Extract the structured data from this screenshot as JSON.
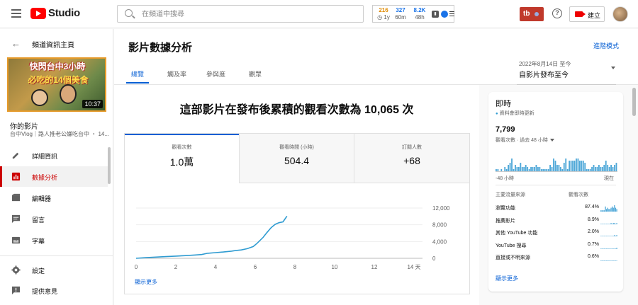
{
  "topbar": {
    "logo_text": "Studio",
    "search_placeholder": "在頻道中搜尋",
    "stats": [
      {
        "value": "216",
        "sub": "◷ 1y",
        "color": "#e08a00"
      },
      {
        "value": "327",
        "sub": "60m",
        "color": "#1a73e8"
      },
      {
        "value": "8.2K",
        "sub": "48h",
        "color": "#1a73e8"
      }
    ],
    "tb_label": "tb",
    "create_label": "建立"
  },
  "sidebar": {
    "back_label": "頻道資訊主頁",
    "thumbnail": {
      "title_line1": "快閃台中3小時",
      "title_line2": "必吃的14個美食",
      "duration": "10:37"
    },
    "your_video_label": "你的影片",
    "video_meta": "台中Vlog｜路人推老公嫌吃台中 ・ 14...",
    "items": [
      {
        "label": "詳細資訊",
        "icon": "pencil-icon",
        "active": false
      },
      {
        "label": "數據分析",
        "icon": "analytics-icon",
        "active": true
      },
      {
        "label": "編輯器",
        "icon": "film-icon",
        "active": false
      },
      {
        "label": "留言",
        "icon": "comment-icon",
        "active": false
      },
      {
        "label": "字幕",
        "icon": "subtitles-icon",
        "active": false
      },
      {
        "label": "設定",
        "icon": "gear-icon",
        "active": false
      },
      {
        "label": "提供意見",
        "icon": "feedback-icon",
        "active": false
      }
    ]
  },
  "main": {
    "title": "影片數據分析",
    "advanced_mode": "進階模式",
    "tabs": [
      {
        "label": "總覽",
        "active": true
      },
      {
        "label": "觸及率",
        "active": false
      },
      {
        "label": "參與度",
        "active": false
      },
      {
        "label": "觀眾",
        "active": false
      }
    ],
    "date_range_small": "2022年8月14日 至今",
    "date_range": "自影片發布至今",
    "headline": "這部影片在發布後累積的觀看次數為 10,065 次",
    "metrics": [
      {
        "label": "觀看次數",
        "value": "1.0萬",
        "active": true
      },
      {
        "label": "觀看時間 (小時)",
        "value": "504.4",
        "active": false
      },
      {
        "label": "訂閱人數",
        "value": "+68",
        "active": false
      }
    ],
    "show_more": "顯示更多"
  },
  "chart_data": {
    "type": "line",
    "x_ticks": [
      "0",
      "2",
      "4",
      "6",
      "8",
      "10",
      "12",
      "14 天"
    ],
    "y_ticks": [
      "0",
      "4,000",
      "8,000",
      "12,000"
    ],
    "xlim": [
      0,
      14
    ],
    "ylim": [
      0,
      12000
    ],
    "x": [
      0,
      0.5,
      1,
      1.5,
      2,
      2.5,
      3,
      3.3,
      3.6,
      4,
      4.4,
      4.8,
      5,
      5.3,
      5.6,
      5.9,
      6.1,
      6.4,
      6.6,
      6.8,
      7,
      7.2,
      7.4,
      7.6
    ],
    "y": [
      0,
      150,
      280,
      400,
      520,
      650,
      800,
      900,
      1200,
      1350,
      1500,
      1700,
      1850,
      2000,
      2300,
      2800,
      3600,
      5000,
      6200,
      7300,
      8100,
      8500,
      8700,
      10065
    ],
    "color": "#2e9bd1"
  },
  "realtime": {
    "title": "即時",
    "subtitle": "資料會即時更新",
    "count": "7,799",
    "count_label": "觀看次數 · 過去 48 小時",
    "axis_left": "-48 小時",
    "axis_right": "現在",
    "bar_values": [
      1,
      1,
      0,
      1,
      0,
      2,
      1,
      3,
      4,
      6,
      1,
      3,
      2,
      2,
      4,
      2,
      2,
      3,
      2,
      1,
      2,
      2,
      2,
      3,
      2,
      2,
      1,
      1,
      1,
      1,
      1,
      3,
      2,
      6,
      5,
      3,
      3,
      2,
      1,
      4,
      6,
      1,
      5,
      5,
      5,
      5,
      6,
      6,
      5,
      5,
      5,
      4,
      1,
      1,
      1,
      2,
      3,
      2,
      2,
      3,
      2,
      2,
      3,
      5,
      3,
      2,
      3,
      2,
      3,
      4
    ],
    "sources_header": "主要流量來源",
    "views_header": "觀看次數",
    "sources": [
      {
        "name": "瀏覽功能",
        "pct": "87.4%",
        "spark": [
          1,
          1,
          1,
          1,
          4,
          2,
          3,
          2,
          2,
          3,
          4,
          3,
          5,
          3,
          2
        ]
      },
      {
        "name": "推薦影片",
        "pct": "8.9%",
        "spark": [
          0,
          0,
          0,
          0,
          0,
          0,
          0,
          0,
          0,
          1,
          0,
          1,
          1,
          0,
          1
        ]
      },
      {
        "name": "其他 YouTube 功能",
        "pct": "2.0%",
        "spark": [
          0,
          0,
          0,
          0,
          0,
          0,
          0,
          0,
          0,
          0,
          0,
          0,
          1,
          0,
          1
        ]
      },
      {
        "name": "YouTube 搜尋",
        "pct": "0.7%",
        "spark": [
          0,
          0,
          0,
          0,
          0,
          0,
          0,
          0,
          0,
          0,
          0,
          0,
          0,
          0,
          1
        ]
      },
      {
        "name": "直接或不明來源",
        "pct": "0.6%",
        "spark": [
          0,
          0,
          0,
          0,
          0,
          0,
          0,
          0,
          0,
          0,
          0,
          0,
          0,
          0,
          0
        ]
      }
    ],
    "show_more": "顯示更多",
    "bar_color": "#4fa8d8"
  }
}
